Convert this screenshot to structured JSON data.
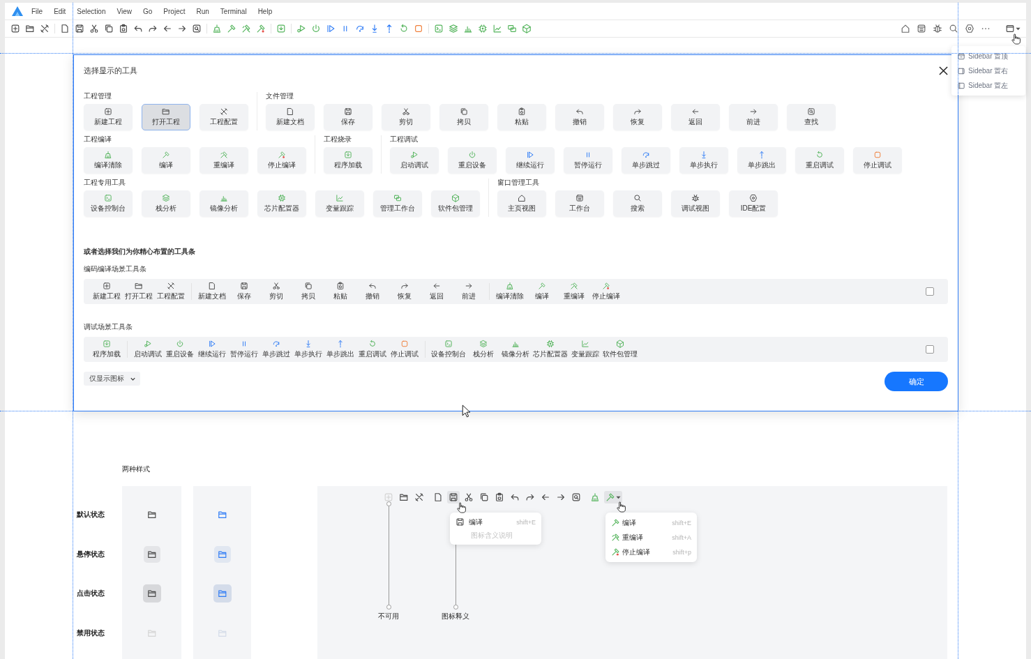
{
  "menu_bar": {
    "items": [
      "File",
      "Edit",
      "Selection",
      "View",
      "Go",
      "Project",
      "Run",
      "Terminal",
      "Help"
    ]
  },
  "toolbar": {
    "groups": [
      [
        {
          "kind": "plus"
        },
        {
          "kind": "folder"
        },
        {
          "kind": "tools"
        }
      ],
      [
        {
          "kind": "document"
        },
        {
          "kind": "save"
        },
        {
          "kind": "scissors"
        },
        {
          "kind": "copy"
        },
        {
          "kind": "paste"
        },
        {
          "kind": "undo"
        },
        {
          "kind": "redo"
        },
        {
          "kind": "left"
        },
        {
          "kind": "right"
        },
        {
          "kind": "find"
        }
      ],
      [
        {
          "kind": "broom"
        },
        {
          "kind": "hammer"
        },
        {
          "kind": "hammers"
        },
        {
          "kind": "hammerstop"
        }
      ],
      [
        {
          "kind": "download"
        }
      ],
      [
        {
          "kind": "debug"
        },
        {
          "kind": "power"
        },
        {
          "kind": "resume"
        },
        {
          "kind": "pause"
        },
        {
          "kind": "stepover"
        },
        {
          "kind": "stepinto"
        },
        {
          "kind": "stepout"
        },
        {
          "kind": "restart"
        },
        {
          "kind": "stop"
        }
      ],
      [
        {
          "kind": "terminal"
        },
        {
          "kind": "layers"
        },
        {
          "kind": "barchart"
        },
        {
          "kind": "chip"
        },
        {
          "kind": "linechart"
        },
        {
          "kind": "windows"
        },
        {
          "kind": "cube"
        }
      ]
    ],
    "right": [
      {
        "kind": "home",
        "has_menu": false
      },
      {
        "kind": "workbench",
        "has_menu": false
      },
      {
        "kind": "bug",
        "has_menu": false
      },
      {
        "kind": "search",
        "has_menu": false
      },
      {
        "kind": "gear",
        "has_menu": false
      },
      {
        "kind": "more",
        "has_menu": false
      },
      {
        "kind": "sidebar",
        "has_menu": true
      }
    ]
  },
  "sidebar_menu": {
    "items": [
      {
        "label": "Sidebar 置顶",
        "kind": "sidetop"
      },
      {
        "label": "Sidebar 置右",
        "kind": "sideright"
      },
      {
        "label": "Sidebar 置左",
        "kind": "sideleft"
      }
    ]
  },
  "dialog": {
    "title": "选择显示的工具",
    "rows": [
      {
        "sections": [
          {
            "title": "工程管理",
            "tools": [
              {
                "label": "新建工程",
                "kind": "plus",
                "selected": false
              },
              {
                "label": "打开工程",
                "kind": "folder",
                "selected": true
              },
              {
                "label": "工程配置",
                "kind": "tools",
                "selected": false
              }
            ]
          },
          {
            "title": "文件管理",
            "tools": [
              {
                "label": "新建文档",
                "kind": "document",
                "selected": false
              },
              {
                "label": "保存",
                "kind": "save",
                "selected": false
              },
              {
                "label": "剪切",
                "kind": "scissors",
                "selected": false
              },
              {
                "label": "拷贝",
                "kind": "copy",
                "selected": false
              },
              {
                "label": "粘贴",
                "kind": "paste",
                "selected": false
              },
              {
                "label": "撤销",
                "kind": "undo",
                "selected": false
              },
              {
                "label": "恢复",
                "kind": "redo",
                "selected": false
              },
              {
                "label": "返回",
                "kind": "left",
                "selected": false
              },
              {
                "label": "前进",
                "kind": "right",
                "selected": false
              },
              {
                "label": "查找",
                "kind": "find",
                "selected": false
              }
            ]
          }
        ]
      },
      {
        "sections": [
          {
            "title": "工程编译",
            "tools": [
              {
                "label": "编译清除",
                "kind": "broom",
                "selected": false
              },
              {
                "label": "编译",
                "kind": "hammer",
                "selected": false
              },
              {
                "label": "重编译",
                "kind": "hammers",
                "selected": false
              },
              {
                "label": "停止编译",
                "kind": "hammerstop",
                "selected": false
              }
            ]
          },
          {
            "title": "工程烧录",
            "tools": [
              {
                "label": "程序加载",
                "kind": "download",
                "selected": false
              }
            ]
          },
          {
            "title": "工程调试",
            "tools": [
              {
                "label": "启动调试",
                "kind": "debug",
                "selected": false
              },
              {
                "label": "重启设备",
                "kind": "power",
                "selected": false
              },
              {
                "label": "继续运行",
                "kind": "resume",
                "selected": false
              },
              {
                "label": "暂停运行",
                "kind": "pause",
                "selected": false
              },
              {
                "label": "单步跳过",
                "kind": "stepover",
                "selected": false
              },
              {
                "label": "单步执行",
                "kind": "stepinto",
                "selected": false
              },
              {
                "label": "单步跳出",
                "kind": "stepout",
                "selected": false
              },
              {
                "label": "重启调试",
                "kind": "restart",
                "selected": false
              },
              {
                "label": "停止调试",
                "kind": "stop",
                "selected": false
              }
            ]
          }
        ]
      },
      {
        "sections": [
          {
            "title": "工程专用工具",
            "tools": [
              {
                "label": "设备控制台",
                "kind": "terminal",
                "selected": false
              },
              {
                "label": "栈分析",
                "kind": "layers",
                "selected": false
              },
              {
                "label": "镜像分析",
                "kind": "barchart",
                "selected": false
              },
              {
                "label": "芯片配置器",
                "kind": "chip",
                "selected": false
              },
              {
                "label": "变量跟踪",
                "kind": "linechart",
                "selected": false
              },
              {
                "label": "管理工作台",
                "kind": "windows",
                "selected": false
              },
              {
                "label": "软件包管理",
                "kind": "cube",
                "selected": false
              }
            ]
          },
          {
            "title": "窗口管理工具",
            "tools": [
              {
                "label": "主页视图",
                "kind": "home",
                "selected": false
              },
              {
                "label": "工作台",
                "kind": "workbench",
                "selected": false
              },
              {
                "label": "搜索",
                "kind": "search",
                "selected": false
              },
              {
                "label": "调试视图",
                "kind": "bug",
                "selected": false
              },
              {
                "label": "IDE配置",
                "kind": "gear",
                "selected": false
              }
            ]
          }
        ]
      }
    ],
    "preset_title": "或者选择我们为你精心布置的工具条",
    "presets": [
      {
        "title": "编码编译场景工具条",
        "checked": false,
        "groups": [
          [
            {
              "label": "新建工程",
              "kind": "plus"
            },
            {
              "label": "打开工程",
              "kind": "folder"
            },
            {
              "label": "工程配置",
              "kind": "tools"
            }
          ],
          [
            {
              "label": "新建文档",
              "kind": "document"
            },
            {
              "label": "保存",
              "kind": "save"
            },
            {
              "label": "剪切",
              "kind": "scissors"
            },
            {
              "label": "拷贝",
              "kind": "copy"
            },
            {
              "label": "粘贴",
              "kind": "paste"
            },
            {
              "label": "撤销",
              "kind": "undo"
            },
            {
              "label": "恢复",
              "kind": "redo"
            },
            {
              "label": "返回",
              "kind": "left"
            },
            {
              "label": "前进",
              "kind": "right"
            }
          ],
          [
            {
              "label": "编译清除",
              "kind": "broom"
            },
            {
              "label": "编译",
              "kind": "hammer"
            },
            {
              "label": "重编译",
              "kind": "hammers"
            },
            {
              "label": "停止编译",
              "kind": "hammerstop"
            }
          ]
        ]
      },
      {
        "title": "调试场景工具条",
        "checked": false,
        "groups": [
          [
            {
              "label": "程序加载",
              "kind": "download"
            }
          ],
          [
            {
              "label": "启动调试",
              "kind": "debug"
            },
            {
              "label": "重启设备",
              "kind": "power"
            },
            {
              "label": "继续运行",
              "kind": "resume"
            },
            {
              "label": "暂停运行",
              "kind": "pause"
            },
            {
              "label": "单步跳过",
              "kind": "stepover"
            },
            {
              "label": "单步执行",
              "kind": "stepinto"
            },
            {
              "label": "单步跳出",
              "kind": "stepout"
            },
            {
              "label": "重启调试",
              "kind": "restart"
            },
            {
              "label": "停止调试",
              "kind": "stop"
            }
          ],
          [
            {
              "label": "设备控制台",
              "kind": "terminal"
            },
            {
              "label": "栈分析",
              "kind": "layers"
            },
            {
              "label": "镜像分析",
              "kind": "barchart"
            },
            {
              "label": "芯片配置器",
              "kind": "chip"
            },
            {
              "label": "变量跟踪",
              "kind": "linechart"
            },
            {
              "label": "软件包管理",
              "kind": "cube"
            }
          ]
        ]
      }
    ],
    "display_mode": "仅显示图标",
    "confirm": "确定"
  },
  "states_demo": {
    "title": "两种样式",
    "states": [
      {
        "label": "默认状态",
        "kind": "default"
      },
      {
        "label": "悬停状态",
        "kind": "hover"
      },
      {
        "label": "点击状态",
        "kind": "pressed"
      },
      {
        "label": "禁用状态",
        "kind": "disabled"
      }
    ]
  },
  "demo": {
    "toolbar": [
      [
        {
          "kind": "plus",
          "disabled": true,
          "hovered": false,
          "has_menu": false
        },
        {
          "kind": "folder",
          "disabled": false,
          "hovered": false,
          "has_menu": false
        },
        {
          "kind": "tools",
          "disabled": false,
          "hovered": false,
          "has_menu": false
        }
      ],
      [
        {
          "kind": "document",
          "disabled": false,
          "hovered": false,
          "has_menu": false
        },
        {
          "kind": "save",
          "disabled": false,
          "hovered": true,
          "has_menu": false
        },
        {
          "kind": "scissors",
          "disabled": false,
          "hovered": false,
          "has_menu": false
        },
        {
          "kind": "copy",
          "disabled": false,
          "hovered": false,
          "has_menu": false
        },
        {
          "kind": "paste",
          "disabled": false,
          "hovered": false,
          "has_menu": false
        },
        {
          "kind": "undo",
          "disabled": false,
          "hovered": false,
          "has_menu": false
        },
        {
          "kind": "redo",
          "disabled": false,
          "hovered": false,
          "has_menu": false
        },
        {
          "kind": "left",
          "disabled": false,
          "hovered": false,
          "has_menu": false
        },
        {
          "kind": "right",
          "disabled": false,
          "hovered": false,
          "has_menu": false
        },
        {
          "kind": "find",
          "disabled": false,
          "hovered": false,
          "has_menu": false
        }
      ],
      [
        {
          "kind": "broom",
          "disabled": false,
          "hovered": false,
          "has_menu": false
        },
        {
          "kind": "hammer",
          "disabled": false,
          "hovered": true,
          "has_menu": true
        }
      ]
    ],
    "tooltip": {
      "kind": "save",
      "label": "编译",
      "shortcut": "shift+E",
      "description": "图标含义说明"
    },
    "menu": {
      "items": [
        {
          "kind": "hammer",
          "label": "编译",
          "shortcut": "shift+E"
        },
        {
          "kind": "hammers",
          "label": "重编译",
          "shortcut": "shift+A"
        },
        {
          "kind": "hammerstop",
          "label": "停止编译",
          "shortcut": "shift+p"
        }
      ]
    },
    "annotations": [
      "不可用",
      "图标释义"
    ]
  }
}
